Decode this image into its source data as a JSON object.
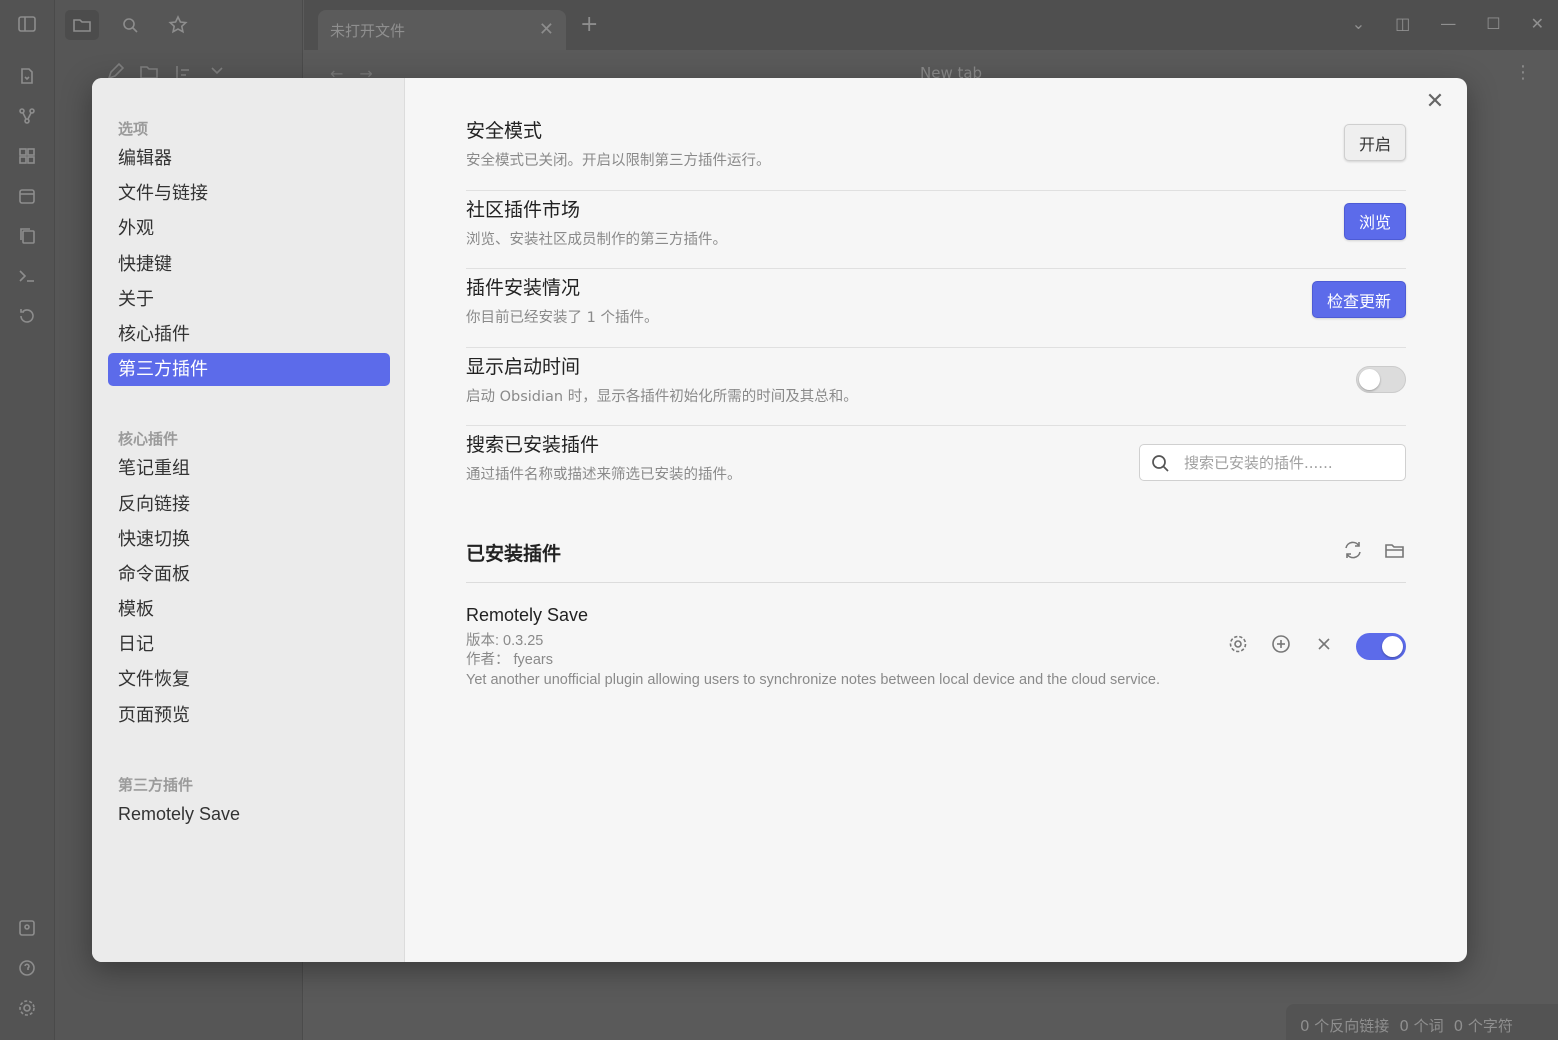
{
  "background": {
    "tab_title": "未打开文件",
    "nav_title": "New tab",
    "status": [
      "0 个反向链接",
      "0 个词",
      "0 个字符"
    ]
  },
  "sidebar": {
    "groups": [
      {
        "title": "选项",
        "items": [
          "编辑器",
          "文件与链接",
          "外观",
          "快捷键",
          "关于",
          "核心插件",
          "第三方插件"
        ],
        "active_index": 6
      },
      {
        "title": "核心插件",
        "items": [
          "笔记重组",
          "反向链接",
          "快速切换",
          "命令面板",
          "模板",
          "日记",
          "文件恢复",
          "页面预览"
        ]
      },
      {
        "title": "第三方插件",
        "items": [
          "Remotely Save"
        ]
      }
    ]
  },
  "settings": [
    {
      "name": "安全模式",
      "desc": "安全模式已关闭。开启以限制第三方插件运行。",
      "control": "button",
      "label": "开启"
    },
    {
      "name": "社区插件市场",
      "desc": "浏览、安装社区成员制作的第三方插件。",
      "control": "button-primary",
      "label": "浏览"
    },
    {
      "name": "插件安装情况",
      "desc": "你目前已经安装了 1 个插件。",
      "control": "button-primary",
      "label": "检查更新"
    },
    {
      "name": "显示启动时间",
      "desc": "启动 Obsidian 时，显示各插件初始化所需的时间及其总和。",
      "control": "toggle",
      "on": false
    },
    {
      "name": "搜索已安装插件",
      "desc": "通过插件名称或描述来筛选已安装的插件。",
      "control": "search",
      "placeholder": "搜索已安装的插件......"
    }
  ],
  "installed": {
    "title": "已安装插件",
    "plugins": [
      {
        "name": "Remotely Save",
        "version": "版本: 0.3.25",
        "author": "作者： fyears",
        "description": "Yet another unofficial plugin allowing users to synchronize notes between local device and the cloud service.",
        "enabled": true
      }
    ]
  },
  "colors": {
    "accent": "#5c6bea"
  }
}
